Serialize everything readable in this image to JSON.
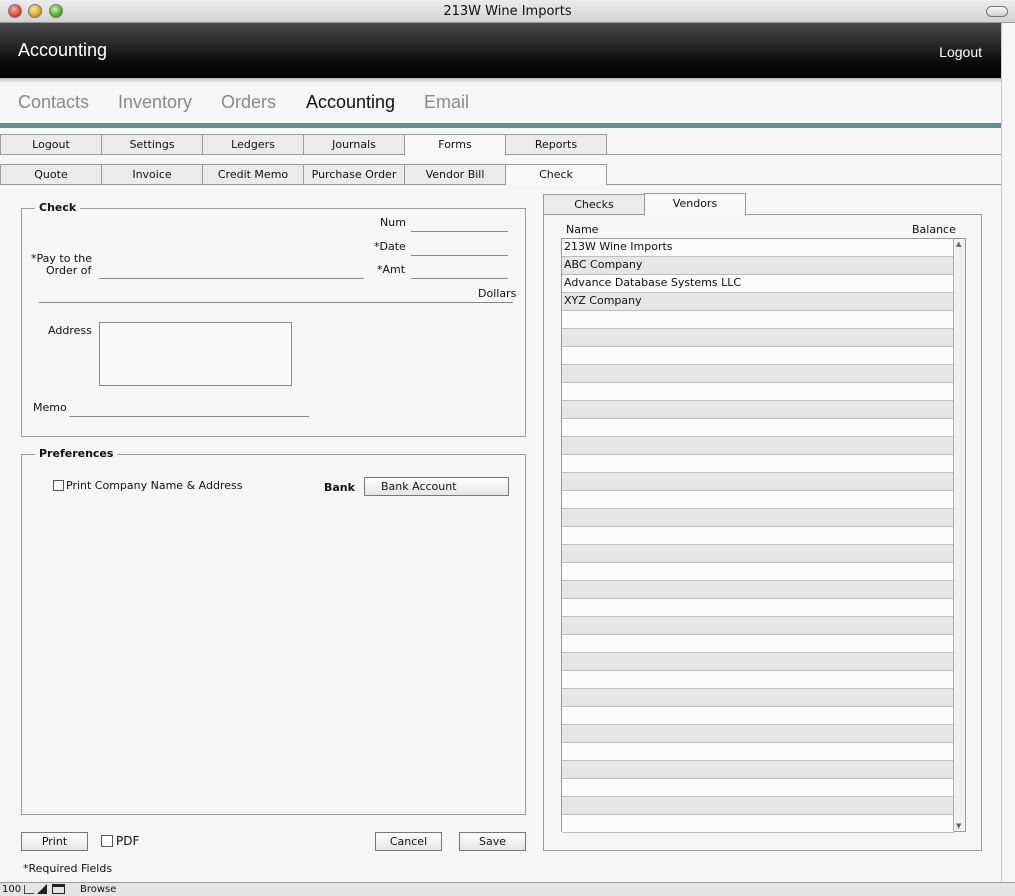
{
  "window": {
    "title": "213W Wine Imports"
  },
  "header": {
    "title": "Accounting",
    "logout": "Logout"
  },
  "main_nav": [
    {
      "label": "Contacts",
      "active": false
    },
    {
      "label": "Inventory",
      "active": false
    },
    {
      "label": "Orders",
      "active": false
    },
    {
      "label": "Accounting",
      "active": true
    },
    {
      "label": "Email",
      "active": false
    }
  ],
  "section_tabs": [
    {
      "label": "Logout",
      "active": false
    },
    {
      "label": "Settings",
      "active": false
    },
    {
      "label": "Ledgers",
      "active": false
    },
    {
      "label": "Journals",
      "active": false
    },
    {
      "label": "Forms",
      "active": true
    },
    {
      "label": "Reports",
      "active": false
    }
  ],
  "form_tabs": [
    {
      "label": "Quote",
      "active": false
    },
    {
      "label": "Invoice",
      "active": false
    },
    {
      "label": "Credit Memo",
      "active": false
    },
    {
      "label": "Purchase Order",
      "active": false
    },
    {
      "label": "Vendor Bill",
      "active": false
    },
    {
      "label": "Check",
      "active": true
    }
  ],
  "check": {
    "legend": "Check",
    "num_label": "Num",
    "date_label": "*Date",
    "amt_label": "*Amt",
    "pay_to_label_1": "*Pay to the",
    "pay_to_label_2": "Order of",
    "dollars_label": "Dollars",
    "address_label": "Address",
    "memo_label": "Memo"
  },
  "preferences": {
    "legend": "Preferences",
    "print_company_label": "Print Company Name & Address",
    "print_company_checked": false,
    "bank_label": "Bank",
    "bank_account_button": "Bank Account"
  },
  "footer": {
    "print_button": "Print",
    "pdf_label": "PDF",
    "pdf_checked": false,
    "cancel_button": "Cancel",
    "save_button": "Save",
    "required_note": "*Required Fields"
  },
  "side_tabs": [
    {
      "label": "Checks",
      "active": false
    },
    {
      "label": "Vendors",
      "active": true
    }
  ],
  "vendors": {
    "columns": [
      "Name",
      "Balance"
    ],
    "rows": [
      {
        "name": "213W Wine Imports",
        "balance": ""
      },
      {
        "name": "ABC Company",
        "balance": ""
      },
      {
        "name": "Advance Database Systems LLC",
        "balance": ""
      },
      {
        "name": "XYZ Company",
        "balance": ""
      }
    ]
  },
  "statusbar": {
    "zoom": "100",
    "mode": "Browse"
  }
}
